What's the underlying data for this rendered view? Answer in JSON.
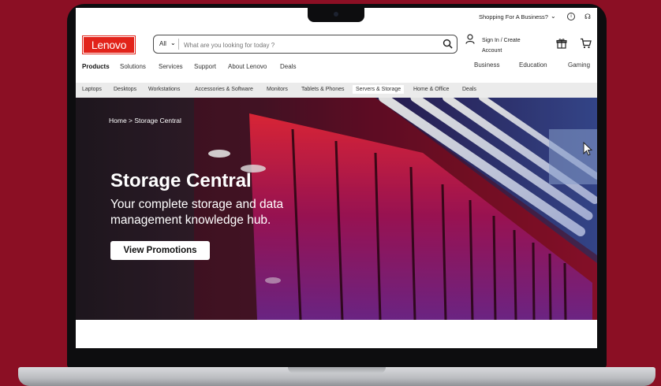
{
  "util": {
    "business_label": "Shopping For A Business?",
    "chevron": "⌄"
  },
  "header": {
    "logo_text": "Lenovo",
    "search_category": "All",
    "search_placeholder": "What are you looking for today ?",
    "signin_line1": "Sign In / Create",
    "signin_line2": "Account"
  },
  "primary_nav": [
    "Products",
    "Solutions",
    "Services",
    "Support",
    "About Lenovo",
    "Deals"
  ],
  "segment_nav": [
    "Business",
    "Education",
    "Gaming"
  ],
  "category_nav": [
    "Laptops",
    "Desktops",
    "Workstations",
    "Accessories & Software",
    "Monitors",
    "Tablets & Phones",
    "Servers & Storage",
    "Home & Office",
    "Deals"
  ],
  "category_active_index": 6,
  "hero": {
    "breadcrumb": "Home > Storage Central",
    "title": "Storage Central",
    "subtitle": "Your complete storage and data management knowledge hub.",
    "button_label": "View Promotions"
  },
  "colors": {
    "brand": "#e2231a",
    "backdrop": "#8b0f24"
  }
}
